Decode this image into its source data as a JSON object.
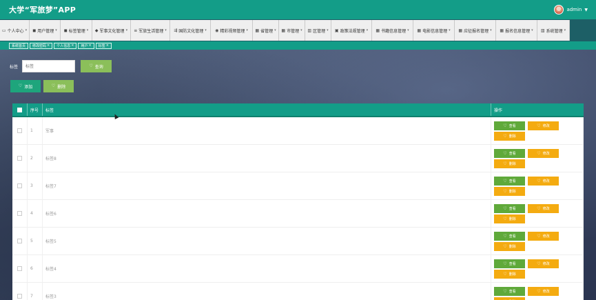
{
  "header": {
    "title": "大学“军旅梦”APP",
    "user": "admin"
  },
  "menu": [
    {
      "icon": "id-card-icon",
      "glyph": "▭",
      "label": "个人中心",
      "has_dropdown": true
    },
    {
      "icon": "user-icon",
      "glyph": "◼",
      "label": "用户管理",
      "has_dropdown": true
    },
    {
      "icon": "tag-icon",
      "glyph": "◼",
      "label": "标签管理",
      "has_dropdown": true
    },
    {
      "icon": "trophy-icon",
      "glyph": "◆",
      "label": "军事文化管理",
      "has_dropdown": true
    },
    {
      "icon": "list-icon",
      "glyph": "≡",
      "label": "军旅生活管理",
      "has_dropdown": true
    },
    {
      "icon": "sliders-icon",
      "glyph": "⇶",
      "label": "国防文化管理",
      "has_dropdown": true
    },
    {
      "icon": "video-icon",
      "glyph": "◉",
      "label": "精彩视频管理",
      "has_dropdown": true
    },
    {
      "icon": "grid-icon",
      "glyph": "▦",
      "label": "省管理",
      "has_dropdown": true
    },
    {
      "icon": "grid-icon",
      "glyph": "▦",
      "label": "市管理",
      "has_dropdown": true
    },
    {
      "icon": "bar-chart-icon",
      "glyph": "▥",
      "label": "区管理",
      "has_dropdown": true
    },
    {
      "icon": "monitor-icon",
      "glyph": "▣",
      "label": "政策法规管理",
      "has_dropdown": true
    },
    {
      "icon": "grid-icon",
      "glyph": "▦",
      "label": "书籍信息管理",
      "has_dropdown": true
    },
    {
      "icon": "grid-icon",
      "glyph": "▦",
      "label": "电影信息管理",
      "has_dropdown": true
    },
    {
      "icon": "grid-icon",
      "glyph": "▦",
      "label": "应征报名管理",
      "has_dropdown": true
    },
    {
      "icon": "grid-icon",
      "glyph": "▦",
      "label": "报名信息管理",
      "has_dropdown": true
    },
    {
      "icon": "bar-chart-icon",
      "glyph": "▥",
      "label": "系统管理",
      "has_dropdown": true
    }
  ],
  "tabs": [
    {
      "label": "系统首页",
      "closable": false
    },
    {
      "label": "修改密码",
      "closable": true
    },
    {
      "label": "个人信息",
      "closable": true
    },
    {
      "label": "用户",
      "closable": true
    },
    {
      "label": "标签",
      "closable": true
    }
  ],
  "search": {
    "label": "标签",
    "placeholder": "标签",
    "button": "查询"
  },
  "actions": {
    "add": "添加",
    "delete": "删除"
  },
  "table": {
    "headers": {
      "no": "序号",
      "tag": "标签",
      "op": "操作"
    },
    "rows": [
      {
        "no": "1",
        "tag": "军事"
      },
      {
        "no": "2",
        "tag": "标签8"
      },
      {
        "no": "3",
        "tag": "标签7"
      },
      {
        "no": "4",
        "tag": "标签6"
      },
      {
        "no": "5",
        "tag": "标签5"
      },
      {
        "no": "6",
        "tag": "标签4"
      },
      {
        "no": "7",
        "tag": "标签3"
      }
    ],
    "row_actions": {
      "view": "查看",
      "edit": "修改",
      "delete": "删除"
    }
  },
  "colors": {
    "primary": "#139d88",
    "view": "#5fa93a",
    "edit": "#f4ab10",
    "query": "#8bbf5a",
    "add": "#1ea57c"
  }
}
